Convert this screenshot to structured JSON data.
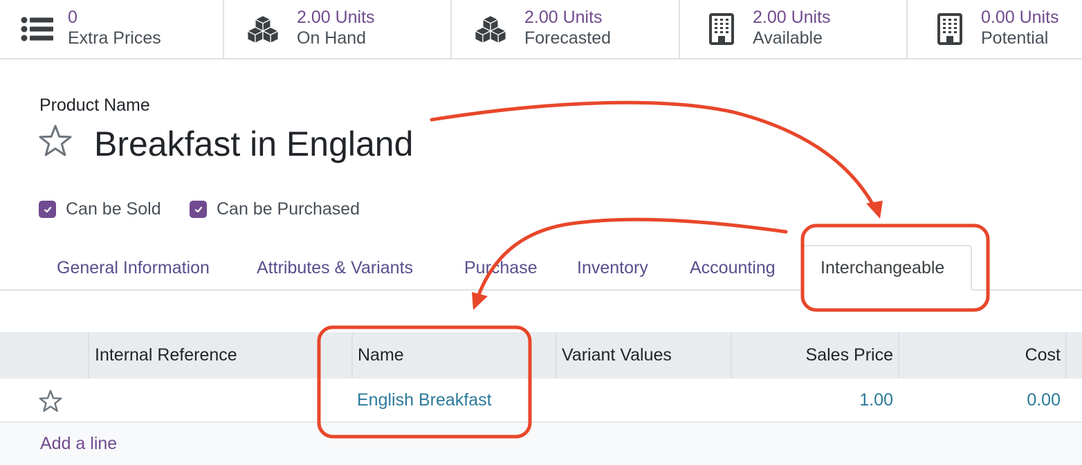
{
  "smart_buttons": [
    {
      "icon": "list-icon",
      "value": "0",
      "label": "Extra Prices"
    },
    {
      "icon": "cubes-icon",
      "value": "2.00 Units",
      "label": "On Hand"
    },
    {
      "icon": "cubes-icon",
      "value": "2.00 Units",
      "label": "Forecasted"
    },
    {
      "icon": "building-icon",
      "value": "2.00 Units",
      "label": "Available"
    },
    {
      "icon": "building-icon",
      "value": "0.00 Units",
      "label": "Potential"
    }
  ],
  "product": {
    "field_label": "Product Name",
    "name": "Breakfast in England",
    "favorite": false,
    "checkboxes": [
      {
        "label": "Can be Sold",
        "checked": true
      },
      {
        "label": "Can be Purchased",
        "checked": true
      }
    ]
  },
  "tabs": [
    {
      "label": "General Information",
      "active": false
    },
    {
      "label": "Attributes & Variants",
      "active": false
    },
    {
      "label": "Purchase",
      "active": false
    },
    {
      "label": "Inventory",
      "active": false
    },
    {
      "label": "Accounting",
      "active": false
    },
    {
      "label": "Interchangeable",
      "active": true
    }
  ],
  "table": {
    "columns": [
      "",
      "Internal Reference",
      "Name",
      "Variant Values",
      "Sales Price",
      "Cost"
    ],
    "rows": [
      {
        "favorite": false,
        "internal_reference": "",
        "name": "English Breakfast",
        "variant_values": "",
        "sales_price": "1.00",
        "cost": "0.00"
      }
    ],
    "add_line_label": "Add a line"
  },
  "annotations": {
    "color": "#e8472b",
    "highlights": [
      "Interchangeable tab",
      "Name column / English Breakfast"
    ]
  }
}
